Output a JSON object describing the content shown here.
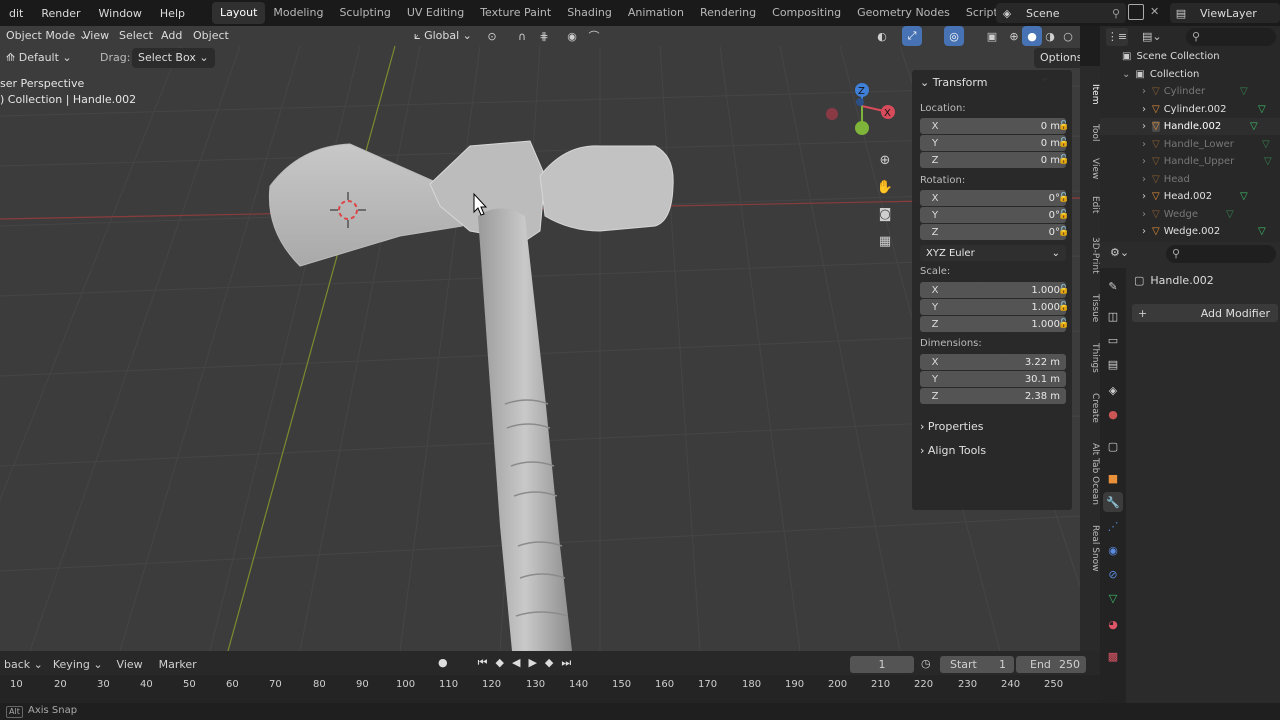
{
  "topbar": {
    "menus": [
      "dit",
      "Render",
      "Window",
      "Help"
    ],
    "workspaces": [
      "Layout",
      "Modeling",
      "Sculpting",
      "UV Editing",
      "Texture Paint",
      "Shading",
      "Animation",
      "Rendering",
      "Compositing",
      "Geometry Nodes",
      "Scripting"
    ],
    "active_workspace": "Layout",
    "add_workspace": "+",
    "scene_name": "Scene",
    "view_layer": "ViewLayer"
  },
  "viewport_header": {
    "mode": "Object Mode",
    "view": "View",
    "select": "Select",
    "add": "Add",
    "object": "Object",
    "orientation_label": "Default",
    "drag_label": "Drag:",
    "drag_value": "Select Box",
    "transform_orientation": "Global",
    "options": "Options"
  },
  "viewport_overlay": {
    "perspective": "ser Perspective",
    "collection_path": ") Collection | Handle.002"
  },
  "npanel": {
    "transform_title": "Transform",
    "location_label": "Location:",
    "location": [
      {
        "axis": "X",
        "value": "0 m"
      },
      {
        "axis": "Y",
        "value": "0 m"
      },
      {
        "axis": "Z",
        "value": "0 m"
      }
    ],
    "rotation_label": "Rotation:",
    "rotation": [
      {
        "axis": "X",
        "value": "0°"
      },
      {
        "axis": "Y",
        "value": "0°"
      },
      {
        "axis": "Z",
        "value": "0°"
      }
    ],
    "rotation_mode": "XYZ Euler",
    "scale_label": "Scale:",
    "scale": [
      {
        "axis": "X",
        "value": "1.000"
      },
      {
        "axis": "Y",
        "value": "1.000"
      },
      {
        "axis": "Z",
        "value": "1.000"
      }
    ],
    "dimensions_label": "Dimensions:",
    "dimensions": [
      {
        "axis": "X",
        "value": "3.22 m"
      },
      {
        "axis": "Y",
        "value": "30.1 m"
      },
      {
        "axis": "Z",
        "value": "2.38 m"
      }
    ],
    "properties_title": "Properties",
    "align_tools_title": "Align Tools"
  },
  "sidebar_tabs": [
    "Item",
    "Tool",
    "View",
    "Edit",
    "3D-Print",
    "Tissue",
    "Things",
    "Create",
    "Alt Tab Ocean",
    "Real Snow"
  ],
  "outliner": {
    "scene_collection": "Scene Collection",
    "collection": "Collection",
    "items": [
      {
        "name": "Cylinder",
        "dim": true
      },
      {
        "name": "Cylinder.002",
        "dim": false
      },
      {
        "name": "Handle.002",
        "dim": false,
        "selected": true
      },
      {
        "name": "Handle_Lower",
        "dim": true
      },
      {
        "name": "Handle_Upper",
        "dim": true
      },
      {
        "name": "Head",
        "dim": true
      },
      {
        "name": "Head.002",
        "dim": false
      },
      {
        "name": "Wedge",
        "dim": true
      },
      {
        "name": "Wedge.002",
        "dim": false
      }
    ]
  },
  "properties": {
    "object_name": "Handle.002",
    "add_modifier": "Add Modifier"
  },
  "timeline": {
    "playback": "back",
    "keying": "Keying",
    "view": "View",
    "marker": "Marker",
    "current_frame": "1",
    "start_label": "Start",
    "start_value": "1",
    "end_label": "End",
    "end_value": "250",
    "ticks": [
      "10",
      "20",
      "30",
      "40",
      "50",
      "60",
      "70",
      "80",
      "90",
      "100",
      "110",
      "120",
      "130",
      "140",
      "150",
      "160",
      "170",
      "180",
      "190",
      "200",
      "210",
      "220",
      "230",
      "240",
      "250"
    ]
  },
  "statusbar": {
    "key": "Alt",
    "hint": "Axis Snap"
  },
  "colors": {
    "accent": "#4772b3",
    "mesh_icon": "#e8903a",
    "vertex_icon": "#3fbf6a",
    "axis_x": "#d84b5b",
    "axis_y": "#7fb43a",
    "axis_z": "#3f7fd8"
  }
}
